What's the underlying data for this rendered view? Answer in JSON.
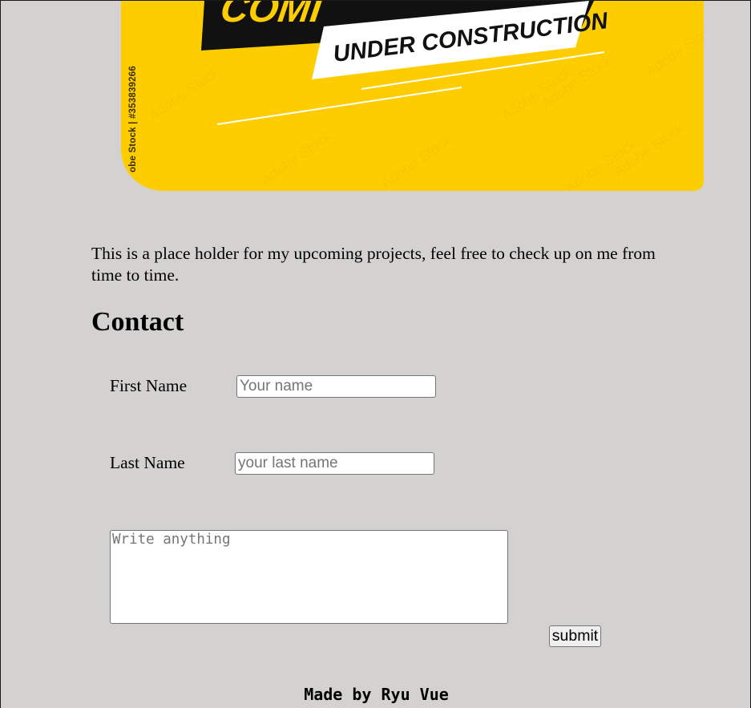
{
  "banner": {
    "headline_fragment": "COMI",
    "subtitle": "UNDER CONSTRUCTION",
    "stock_credit": "obe Stock | #353839266",
    "watermark": "Adobe Stock",
    "colors": {
      "background": "#fecd00",
      "dark_band": "#111111",
      "label_box": "#ffffff",
      "label_text": "#111111"
    }
  },
  "intro": {
    "text": "This is a place holder for my upcoming projects, feel free to check up on me from time to time."
  },
  "contact": {
    "heading": "Contact",
    "first_name": {
      "label": "First Name",
      "placeholder": "Your name",
      "value": ""
    },
    "last_name": {
      "label": "Last Name",
      "placeholder": "your last name",
      "value": ""
    },
    "message": {
      "placeholder": "Write anything",
      "value": ""
    },
    "submit_label": "submit"
  },
  "footer": {
    "credit": "Made by Ryu Vue"
  },
  "colors": {
    "page_background": "#d3d2d1",
    "text": "#000000"
  }
}
